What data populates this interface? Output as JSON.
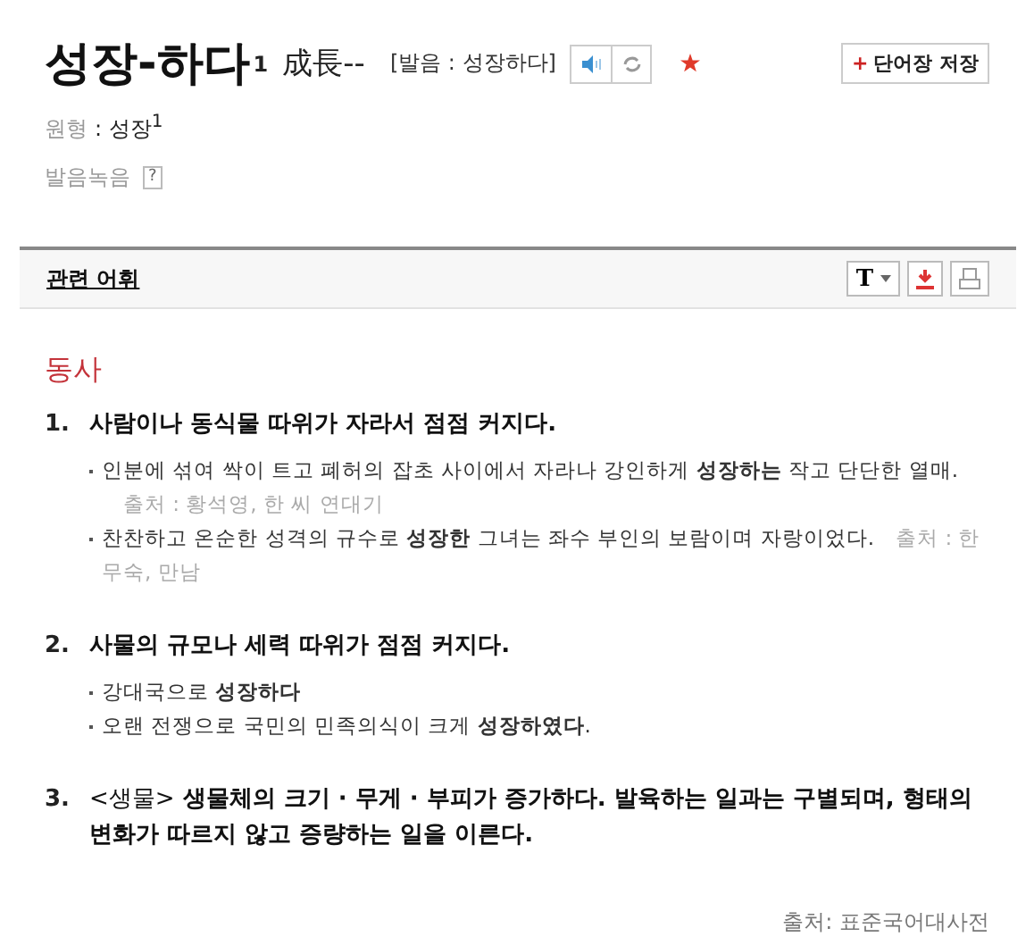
{
  "headword": {
    "word": "성장-하다",
    "superscript": "1",
    "hanja": "成長--",
    "pronunciation": "[발음 : 성장하다]",
    "starred": true
  },
  "save_button": {
    "icon": "+",
    "label": "단어장 저장"
  },
  "base_form": {
    "label": "원형",
    "value": ": 성장$^{1}$"
  },
  "recording": {
    "label": "발음녹음",
    "help": "?"
  },
  "toolbar": {
    "tab": "관련 어휘",
    "font_button": "T"
  },
  "part_of_speech": "동사",
  "senses": [
    {
      "number": "1.",
      "definition": "사람이나 동식물 따위가 자라서 점점 커지다.",
      "examples": [
        {
          "text": "인분에 섞여 싹이 트고 폐허의 잡초 사이에서 자라나 강인하게 **성장하는** 작고 단단한 열매.",
          "source": "출처 : 황석영, 한 씨 연대기"
        },
        {
          "text": "찬찬하고 온순한 성격의 규수로 **성장한** 그녀는 좌수 부인의 보람이며 자랑이었다.",
          "source": "출처 : 한무숙, 만남"
        }
      ]
    },
    {
      "number": "2.",
      "definition": "사물의 규모나 세력 따위가 점점 커지다.",
      "examples": [
        {
          "text": "강대국으로 **성장하다**"
        },
        {
          "text": "오랜 전쟁으로 국민의 민족의식이 크게 **성장하였다**."
        }
      ]
    },
    {
      "number": "3.",
      "field": "<생물>",
      "definition": "생물체의 크기 · 무게 · 부피가 증가하다. 발육하는 일과는 구별되며, 형태의 변화가 따르지 않고 증량하는 일을 이른다."
    }
  ],
  "footer_source": "출처: 표준국어대사전"
}
